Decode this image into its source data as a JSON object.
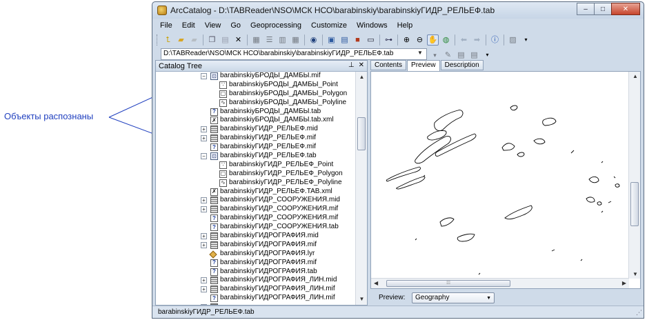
{
  "annotation": {
    "label": "Объекты распознаны"
  },
  "window": {
    "title": "ArcCatalog - D:\\TABReader\\NSO\\МСК НСО\\barabinskiy\\barabinskiyГИДР_РЕЛЬЕФ.tab",
    "minimize": "‒",
    "maximize": "□",
    "close": "✕"
  },
  "menu": [
    "File",
    "Edit",
    "View",
    "Go",
    "Geoprocessing",
    "Customize",
    "Windows",
    "Help"
  ],
  "toolbar": {
    "icons": [
      "up-one-level-icon",
      "connect-folder-icon",
      "disconnect-folder-icon",
      "copy-icon",
      "paste-icon",
      "delete-icon",
      "large-icons-icon",
      "list-icon",
      "details-icon",
      "thumbnails-icon",
      "launch-arcmap-icon",
      "catalog-window-icon",
      "search-window-icon",
      "arctoolbox-icon",
      "python-window-icon",
      "model-builder-icon",
      "zoom-in-icon",
      "zoom-out-icon",
      "pan-icon",
      "full-extent-icon",
      "back-icon",
      "forward-icon",
      "identify-icon",
      "create-thumbnail-icon"
    ]
  },
  "address": {
    "value": "D:\\TABReader\\NSO\\МСК НСО\\barabinskiy\\barabinskiyГИДР_РЕЛЬЕФ.tab"
  },
  "catalog_tree": {
    "title": "Catalog Tree",
    "pin": "⊥",
    "close": "✕",
    "items": [
      {
        "level": 0,
        "expander": "−",
        "icon": "dataset",
        "label": "barabinskiyБРОДЫ_ДАМБЫ.mif"
      },
      {
        "level": 1,
        "expander": "",
        "icon": "point",
        "label": "barabinskiyБРОДЫ_ДАМБЫ_Point"
      },
      {
        "level": 1,
        "expander": "",
        "icon": "polygon",
        "label": "barabinskiyБРОДЫ_ДАМБЫ_Polygon"
      },
      {
        "level": 1,
        "expander": "",
        "icon": "polyline",
        "label": "barabinskiyБРОДЫ_ДАМБЫ_Polyline"
      },
      {
        "level": 0,
        "expander": "",
        "icon": "unknown",
        "label": "barabinskiyБРОДЫ_ДАМБЫ.tab"
      },
      {
        "level": 0,
        "expander": "",
        "icon": "xml",
        "label": "barabinskiyБРОДЫ_ДАМБЫ.tab.xml"
      },
      {
        "level": 0,
        "expander": "+",
        "icon": "table",
        "label": "barabinskiyГИДР_РЕЛЬЕФ.mid"
      },
      {
        "level": 0,
        "expander": "+",
        "icon": "table",
        "label": "barabinskiyГИДР_РЕЛЬЕФ.mif"
      },
      {
        "level": 0,
        "expander": "",
        "icon": "unknown",
        "label": "barabinskiyГИДР_РЕЛЬЕФ.mif"
      },
      {
        "level": 0,
        "expander": "−",
        "icon": "dataset",
        "label": "barabinskiyГИДР_РЕЛЬЕФ.tab"
      },
      {
        "level": 1,
        "expander": "",
        "icon": "point",
        "label": "barabinskiyГИДР_РЕЛЬЕФ_Point"
      },
      {
        "level": 1,
        "expander": "",
        "icon": "polygon",
        "label": "barabinskiyГИДР_РЕЛЬЕФ_Polygon"
      },
      {
        "level": 1,
        "expander": "",
        "icon": "polyline",
        "label": "barabinskiyГИДР_РЕЛЬЕФ_Polyline"
      },
      {
        "level": 0,
        "expander": "",
        "icon": "xml",
        "label": "barabinskiyГИДР_РЕЛЬЕФ.TAB.xml"
      },
      {
        "level": 0,
        "expander": "+",
        "icon": "table",
        "label": "barabinskiyГИДР_СООРУЖЕНИЯ.mid"
      },
      {
        "level": 0,
        "expander": "+",
        "icon": "table",
        "label": "barabinskiyГИДР_СООРУЖЕНИЯ.mif"
      },
      {
        "level": 0,
        "expander": "",
        "icon": "unknown",
        "label": "barabinskiyГИДР_СООРУЖЕНИЯ.mif"
      },
      {
        "level": 0,
        "expander": "",
        "icon": "unknown",
        "label": "barabinskiyГИДР_СООРУЖЕНИЯ.tab"
      },
      {
        "level": 0,
        "expander": "+",
        "icon": "table",
        "label": "barabinskiyГИДРОГРАФИЯ.mid"
      },
      {
        "level": 0,
        "expander": "+",
        "icon": "table",
        "label": "barabinskiyГИДРОГРАФИЯ.mif"
      },
      {
        "level": 0,
        "expander": "",
        "icon": "lyr",
        "label": "barabinskiyГИДРОГРАФИЯ.lyr"
      },
      {
        "level": 0,
        "expander": "",
        "icon": "unknown",
        "label": "barabinskiyГИДРОГРАФИЯ.mif"
      },
      {
        "level": 0,
        "expander": "",
        "icon": "unknown",
        "label": "barabinskiyГИДРОГРАФИЯ.tab"
      },
      {
        "level": 0,
        "expander": "+",
        "icon": "table",
        "label": "barabinskiyГИДРОГРАФИЯ_ЛИН.mid"
      },
      {
        "level": 0,
        "expander": "+",
        "icon": "table",
        "label": "barabinskiyГИДРОГРАФИЯ_ЛИН.mif"
      },
      {
        "level": 0,
        "expander": "",
        "icon": "unknown",
        "label": "barabinskiyГИДРОГРАФИЯ_ЛИН.mif"
      },
      {
        "level": 0,
        "expander": "+",
        "icon": "table",
        "label": ""
      }
    ]
  },
  "preview": {
    "tabs": [
      "Contents",
      "Preview",
      "Description"
    ],
    "active_tab": "Preview",
    "label": "Preview:",
    "mode": "Geography"
  },
  "status": {
    "text": "barabinskiyГИДР_РЕЛЬЕФ.tab"
  }
}
